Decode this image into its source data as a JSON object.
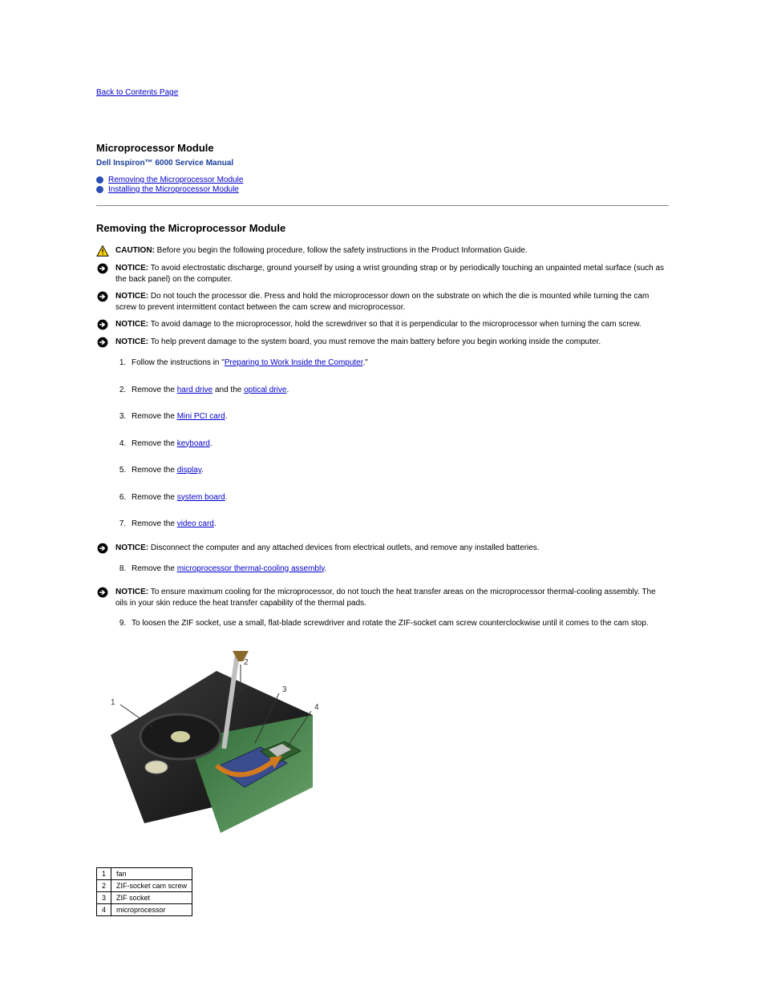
{
  "back_link": "Back to Contents Page",
  "page_title": "Microprocessor Module",
  "manual_title": "Dell Inspiron™ 6000 Service Manual",
  "toc": {
    "items": [
      "Removing the Microprocessor Module",
      "Installing the Microprocessor Module"
    ]
  },
  "section1_heading": "Removing the Microprocessor Module",
  "callouts": {
    "caution_label": "CAUTION:",
    "caution_text": " Before you begin the following procedure, follow the safety instructions in the Product Information Guide.",
    "notice1_label": "NOTICE:",
    "notice1_text": " To avoid electrostatic discharge, ground yourself by using a wrist grounding strap or by periodically touching an unpainted metal surface (such as the back panel) on the computer.",
    "notice2_label": "NOTICE:",
    "notice2_text": " Do not touch the processor die. Press and hold the microprocessor down on the substrate on which the die is mounted while turning the cam screw to prevent intermittent contact between the cam screw and microprocessor.",
    "notice3_label": "NOTICE:",
    "notice3_text": " To avoid damage to the microprocessor, hold the screwdriver so that it is perpendicular to the microprocessor when turning the cam screw.",
    "notice4_label": "NOTICE:",
    "notice4_text": " To help prevent damage to the system board, you must remove the main battery before you begin working inside the computer.",
    "notice5_label": "NOTICE:",
    "notice5_text": " Disconnect the computer and any attached devices from electrical outlets, and remove any installed batteries.",
    "notice6_label": "NOTICE:",
    "notice6_text": " To ensure maximum cooling for the microprocessor, do not touch the heat transfer areas on the microprocessor thermal-cooling assembly. The oils in your skin reduce the heat transfer capability of the thermal pads."
  },
  "steps1": {
    "s1a": "Follow the instructions in \"",
    "s1_link": "Preparing to Work Inside the Computer",
    "s1b": ".\"",
    "s2a": "Remove the ",
    "s2_link1": "hard drive",
    "s2b": " and the ",
    "s2_link2": "optical drive",
    "s2c": ".",
    "s3a": "Remove the ",
    "s3_link": "Mini PCI card",
    "s3b": ".",
    "s4a": "Remove the ",
    "s4_link": "keyboard",
    "s4b": ".",
    "s5a": "Remove the ",
    "s5_link": "display",
    "s5b": ".",
    "s6a": "Remove the ",
    "s6_link": "system board",
    "s6b": ".",
    "s7a": "Remove the ",
    "s7_link": "video card",
    "s7b": "."
  },
  "step8a": "Remove the ",
  "step8_link": "microprocessor thermal-cooling assembly",
  "step8b": ".",
  "step9": "To loosen the ZIF socket, use a small, flat-blade screwdriver and rotate the ZIF-socket cam screw counterclockwise until it comes to the cam stop.",
  "parts": {
    "r1n": "1",
    "r1t": "fan",
    "r2n": "2",
    "r2t": "ZIF-socket cam screw",
    "r3n": "3",
    "r3t": "ZIF socket",
    "r4n": "4",
    "r4t": "microprocessor"
  }
}
